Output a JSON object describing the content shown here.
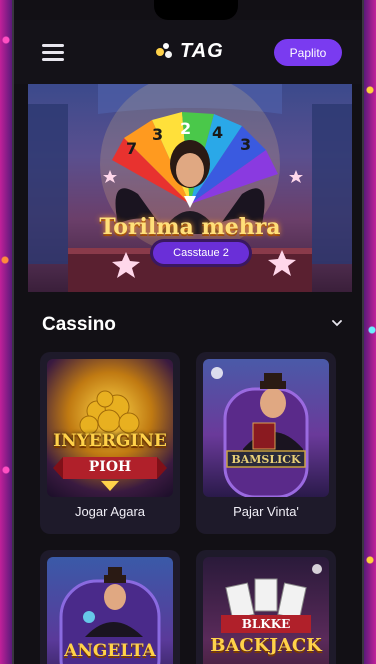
{
  "header": {
    "logo_text": "TAG",
    "cta_label": "Paplito"
  },
  "hero": {
    "title": "Torilma mehra",
    "button_label": "Casstaue 2",
    "wheel_numbers": [
      "7",
      "3",
      "2",
      "4",
      "3"
    ]
  },
  "section": {
    "title": "Cassino"
  },
  "games": [
    {
      "thumb_text": "INYERGINE",
      "thumb_sub": "PIOH",
      "name": "Jogar Agara"
    },
    {
      "thumb_text": "BAMSLICK",
      "thumb_sub": "",
      "name": "Pajar Vinta'"
    },
    {
      "thumb_text": "ANGELTA",
      "thumb_sub": "",
      "name": ""
    },
    {
      "thumb_text": "BLKKE",
      "thumb_sub": "BACKJACK",
      "name": ""
    }
  ],
  "colors": {
    "accent": "#7a3bf0",
    "background": "#121015",
    "card": "#1e1a2a",
    "gold": "#ffd24a"
  }
}
